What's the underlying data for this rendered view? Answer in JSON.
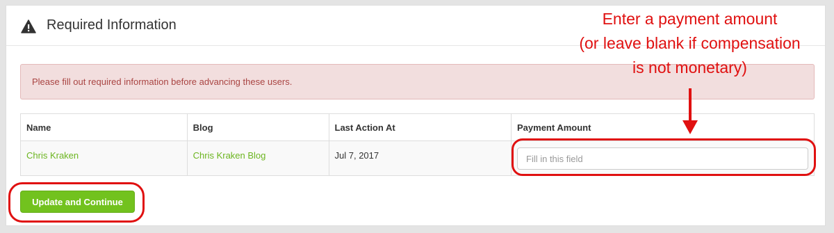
{
  "panel": {
    "title": "Required Information",
    "icon": "warning-triangle-icon"
  },
  "alert": {
    "message": "Please fill out required information before advancing these users.",
    "color": "#a94442",
    "background": "#f2dede"
  },
  "table": {
    "columns": [
      "Name",
      "Blog",
      "Last Action At",
      "Payment Amount"
    ],
    "rows": [
      {
        "name": "Chris Kraken",
        "blog": "Chris Kraken Blog",
        "last_action_at": "Jul 7, 2017",
        "payment_amount": {
          "value": "",
          "placeholder": "Fill in this field"
        }
      }
    ]
  },
  "actions": {
    "submit_label": "Update and Continue",
    "submit_color": "#72c21e"
  },
  "annotation": {
    "lines": [
      "Enter a payment amount",
      "(or leave blank if compensation",
      "is not monetary)"
    ],
    "color": "#e01010"
  },
  "link_color": "#6cb520"
}
